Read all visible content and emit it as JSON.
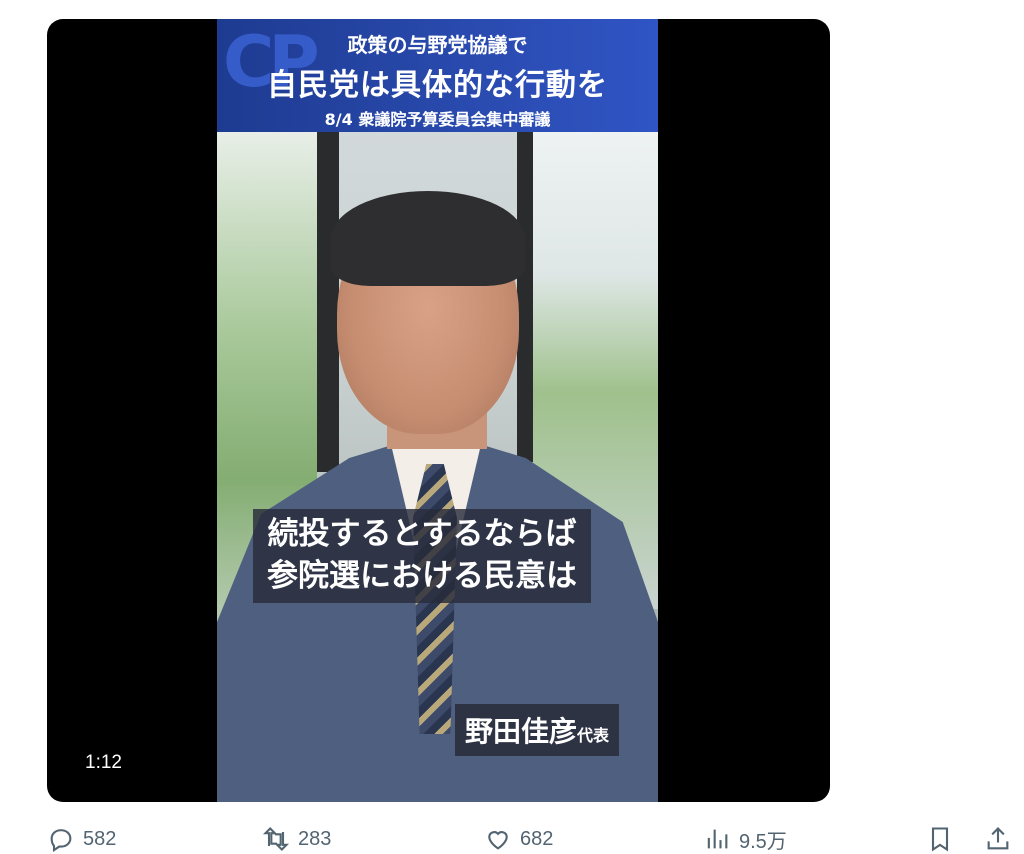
{
  "video": {
    "banner": {
      "line1": "政策の与野党協議で",
      "line2": "自民党は具体的な行動を",
      "line3": "8/4 衆議院予算委員会集中審議"
    },
    "subtitle": {
      "line1": "続投するとするならば",
      "line2": "参院選における民意は"
    },
    "name_tag": {
      "name": "野田佳彦",
      "role": "代表"
    },
    "duration": "1:12"
  },
  "actions": {
    "replies": "582",
    "reposts": "283",
    "likes": "682",
    "views": "9.5万"
  },
  "icons": [
    "reply-icon",
    "repost-icon",
    "like-icon",
    "views-icon",
    "bookmark-icon",
    "share-icon"
  ],
  "colors": {
    "banner_blue": "#2a4bb0",
    "action_gray": "#536471"
  }
}
